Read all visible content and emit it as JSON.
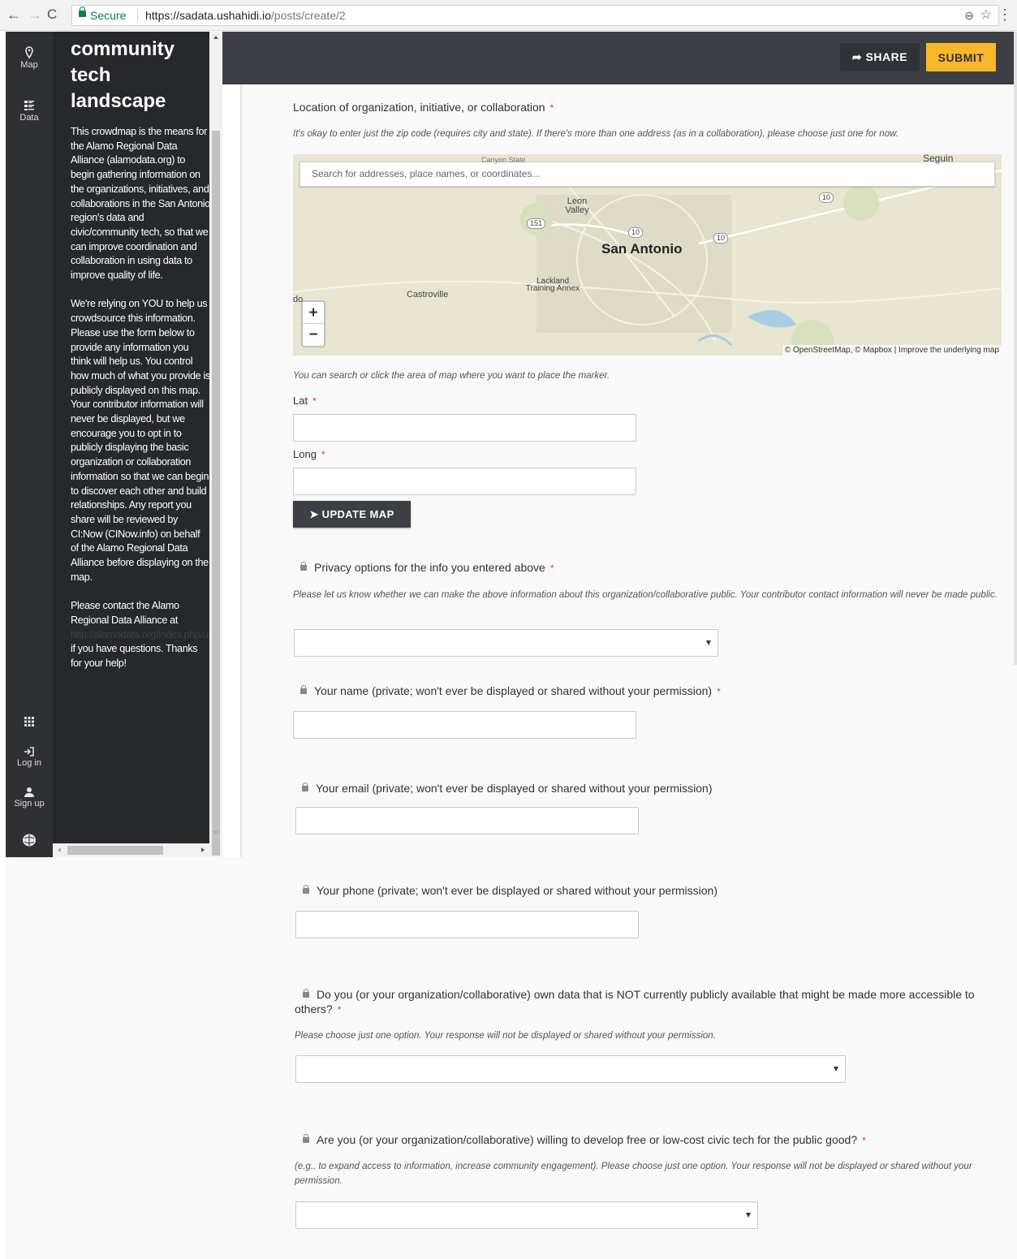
{
  "browser": {
    "secure_label": "Secure",
    "url_host": "https://sadata.ushahidi.io",
    "url_path": "/posts/create/2"
  },
  "rail": {
    "map_label": "Map",
    "data_label": "Data",
    "login_label": "Log in",
    "signup_label": "Sign up"
  },
  "sidebar": {
    "title": "community tech landscape",
    "para1": "This crowdmap is the means for the Alamo Regional Data Alliance (alamodata.org) to begin gathering information on the organizations, initiatives, and collaborations in the San Antonio region's data and civic/community tech, so that we can improve coordination and collaboration in using data to improve quality of life.",
    "para2": "We're relying on YOU to help us crowdsource this information. Please use the form below to provide any information you think will help us. You control how much of what you provide is publicly displayed on this map. Your contributor information will never be displayed, but we encourage you to opt in to publicly displaying the basic organization or collaboration information so that we can begin to discover each other and build relationships. Any report you share will be reviewed by CI:Now (CINow.info) on behalf of the Alamo Regional Data Alliance before displaying on the map.",
    "para3_before": "Please contact the Alamo Regional Data Alliance at ",
    "para3_link": "http://alamodata.org/index.php/us/",
    "para3_after": " if you have questions. Thanks for your help!"
  },
  "toolbar": {
    "share_label": "SHARE",
    "submit_label": "SUBMIT"
  },
  "form": {
    "required_mark": "*",
    "location": {
      "label": "Location of organization, initiative, or collaboration",
      "hint": "It's okay to enter just the zip code (requires city and state). If there's more than one address (as in a collaboration), please choose just one for now."
    },
    "map": {
      "search_placeholder": "Search for addresses, place names, or coordinates...",
      "attribution": "© OpenStreetMap, © Mapbox | Improve the underlying map",
      "cities": {
        "san_antonio": "San Antonio",
        "leon_valley": "Leon Valley",
        "castroville": "Castroville",
        "lackland": "Lackland Training Annex",
        "seguin": "Seguin",
        "canyon_state": "Canyon State",
        "cut_edge": "do"
      },
      "highway_151": "151",
      "highway_10": "10",
      "hint_below": "You can search or click the area of map where you want to place the marker."
    },
    "lat_label": "Lat",
    "long_label": "Long",
    "update_map_label": "UPDATE MAP",
    "privacy": {
      "label": "Privacy options for the info you entered above",
      "hint": "Please let us know whether we can make the above information about this organization/collaborative public. Your contributor contact information will never be made public."
    },
    "name_label": "Your name (private; won't ever be displayed or shared without your permission)",
    "email_label": "Your email (private; won't ever be displayed or shared without your permission)",
    "phone_label": "Your phone (private; won't ever be displayed or shared without your permission)",
    "own_data": {
      "label": "Do you (or your organization/collaborative) own data that is NOT currently publicly available that might be made more accessible to others?",
      "hint": "Please choose just one option. Your response will not be displayed or shared without your permission."
    },
    "civic_tech": {
      "label": "Are you (or your organization/collaborative) willing to develop free or low-cost civic tech for the public good?",
      "hint": "(e.g., to expand access to information, increase community engagement). Please choose just one option. Your response will not be displayed or shared without your permission."
    }
  }
}
